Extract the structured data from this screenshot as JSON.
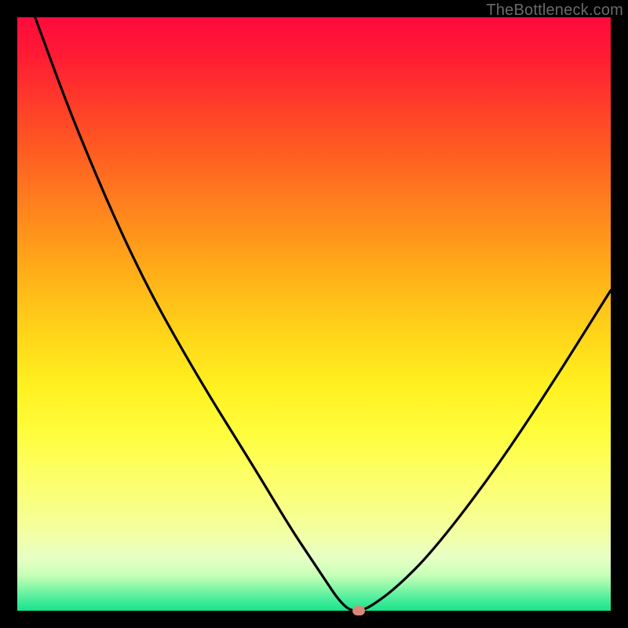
{
  "credit": "TheBottleneck.com",
  "colors": {
    "frame": "#000000",
    "curve": "#000000",
    "dot": "#d6887a",
    "gradient_stops": [
      "#ff0a3c",
      "#ff1a34",
      "#ff3a2a",
      "#ff5a22",
      "#ff7a1f",
      "#ff9a1a",
      "#ffba18",
      "#ffd71a",
      "#fff020",
      "#fffd3c",
      "#fdff60",
      "#f9ff82",
      "#f2ffa4",
      "#e8ffc4",
      "#c6ffb8",
      "#8cf7a8",
      "#4bed9c",
      "#18e48a"
    ]
  },
  "chart_data": {
    "type": "line",
    "title": "",
    "xlabel": "",
    "ylabel": "",
    "xlim": [
      0,
      100
    ],
    "ylim": [
      0,
      100
    ],
    "grid": false,
    "legend": false,
    "annotations": [
      "TheBottleneck.com"
    ],
    "series": [
      {
        "name": "curve",
        "x": [
          3,
          10,
          20,
          30,
          40,
          46,
          50,
          52,
          54,
          56,
          58,
          60,
          64,
          70,
          80,
          90,
          100
        ],
        "values": [
          100,
          81,
          58,
          40,
          24,
          14,
          8,
          5,
          2,
          0,
          0,
          1,
          4,
          10,
          23,
          38,
          54
        ]
      }
    ],
    "marker": {
      "x": 57.5,
      "y": 0
    }
  }
}
